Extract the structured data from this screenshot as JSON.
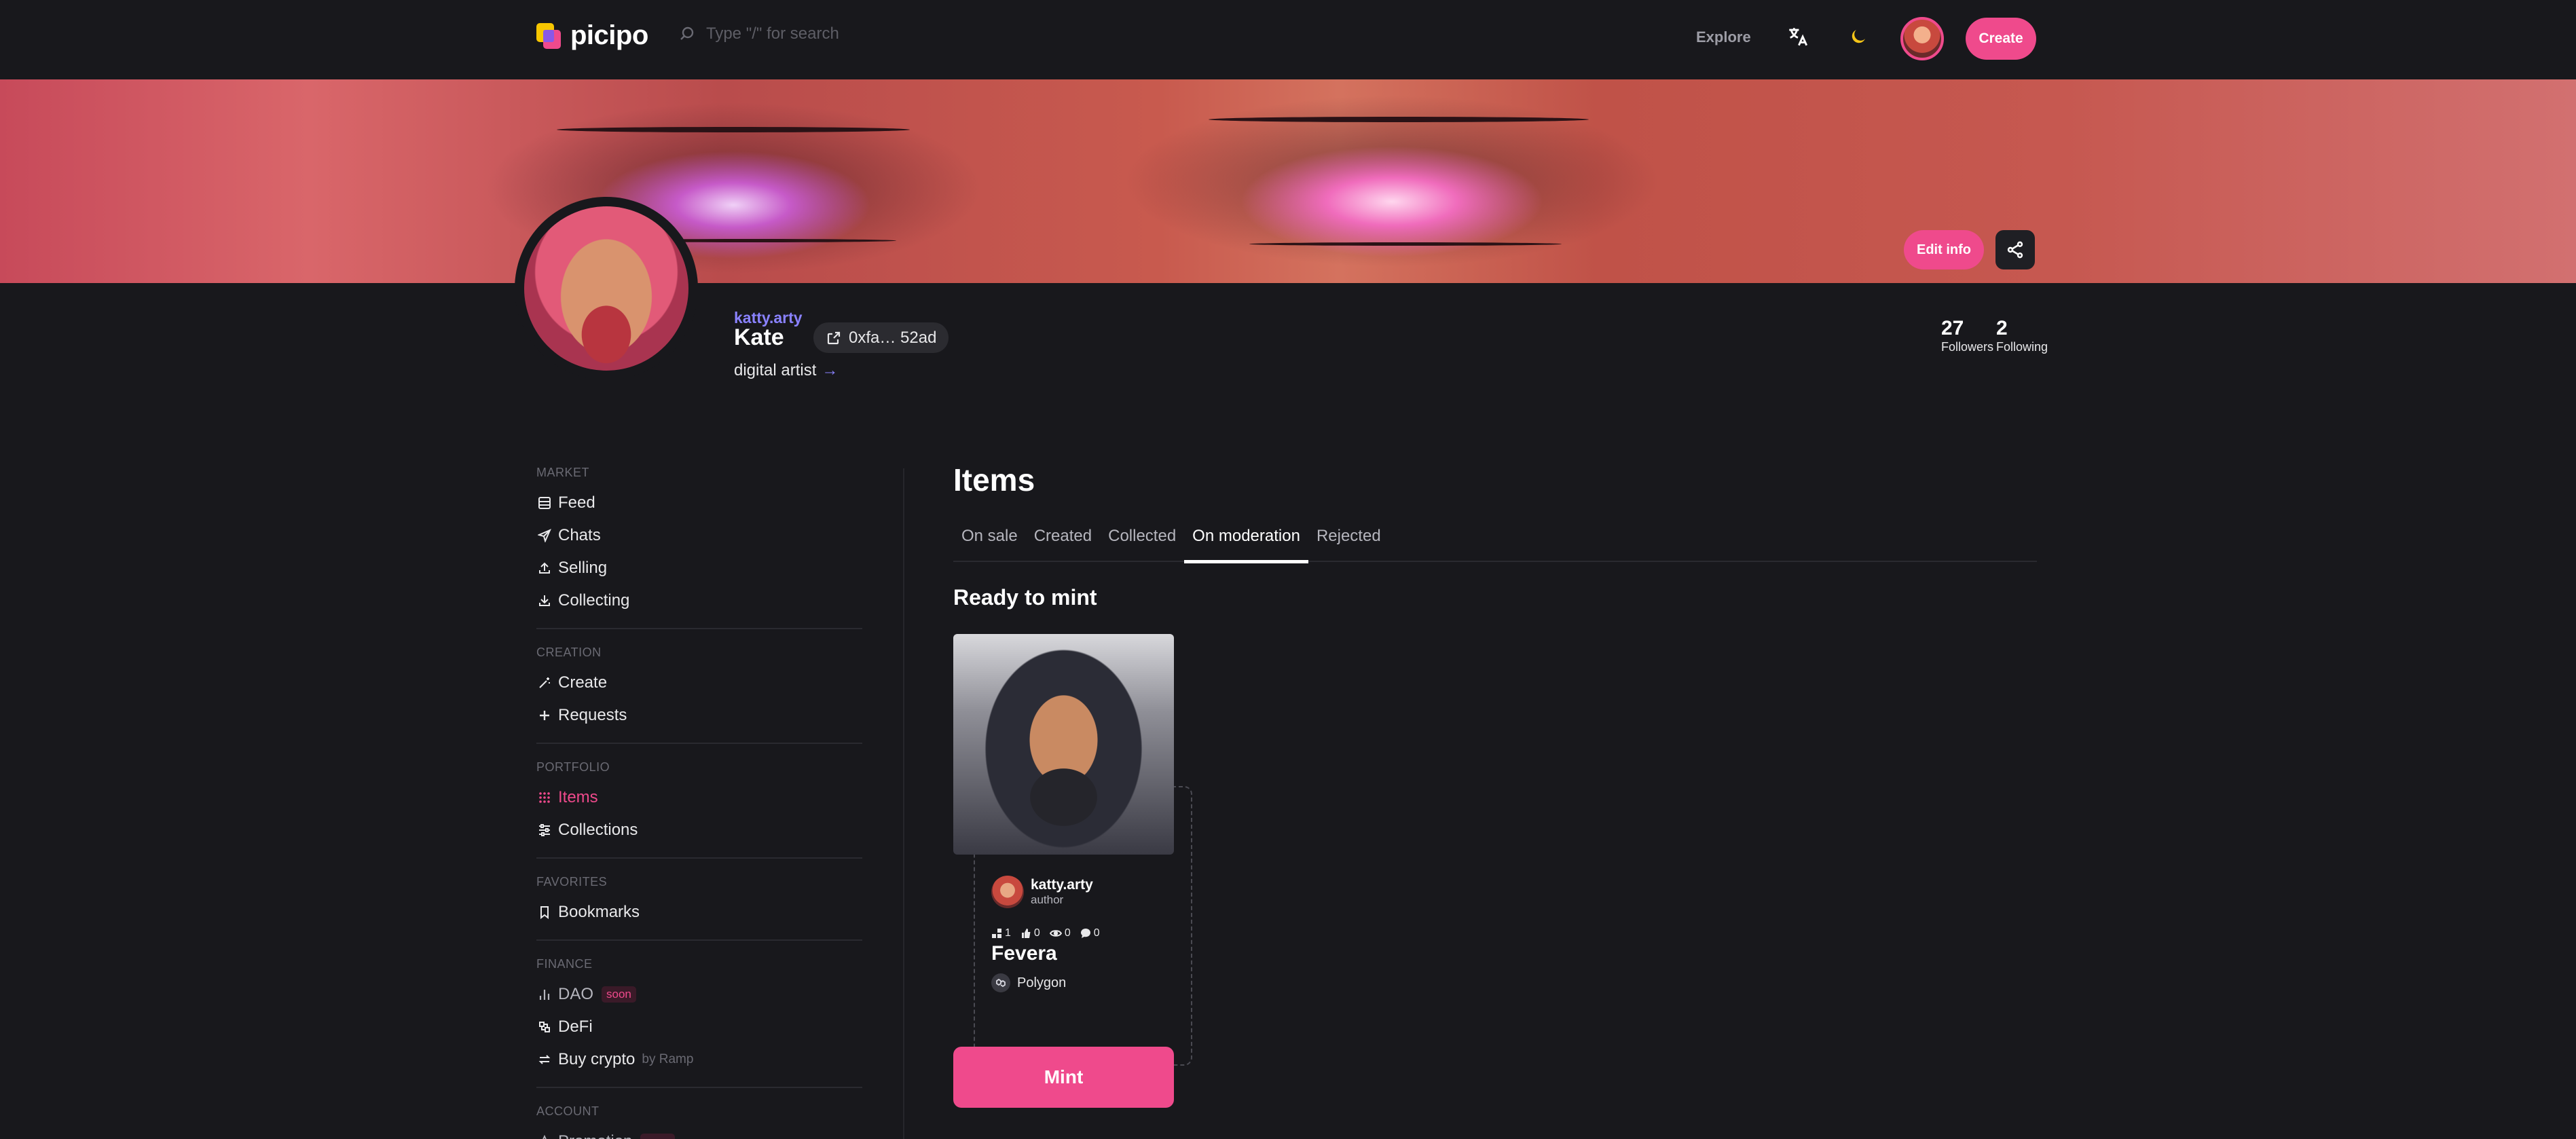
{
  "header": {
    "logo_text": "picipo",
    "search_placeholder": "Type \"/\" for search",
    "explore_label": "Explore",
    "create_label": "Create",
    "icons": [
      "search-icon",
      "translate-icon",
      "moon-icon"
    ]
  },
  "profile": {
    "username": "katty.arty",
    "name": "Kate",
    "address": "0xfa… 52ad",
    "bio": "digital artist",
    "edit_label": "Edit info",
    "followers_count": "27",
    "followers_label": "Followers",
    "following_count": "2",
    "following_label": "Following"
  },
  "sidebar": {
    "sections": [
      {
        "title": "MARKET",
        "items": [
          {
            "label": "Feed",
            "icon": "feed-icon"
          },
          {
            "label": "Chats",
            "icon": "send-icon"
          },
          {
            "label": "Selling",
            "icon": "upload-icon"
          },
          {
            "label": "Collecting",
            "icon": "download-icon"
          }
        ]
      },
      {
        "title": "CREATION",
        "items": [
          {
            "label": "Create",
            "icon": "magic-wand-icon"
          },
          {
            "label": "Requests",
            "icon": "plus-icon"
          }
        ]
      },
      {
        "title": "PORTFOLIO",
        "items": [
          {
            "label": "Items",
            "icon": "grid-icon",
            "active": true
          },
          {
            "label": "Collections",
            "icon": "sliders-icon"
          }
        ]
      },
      {
        "title": "FAVORITES",
        "items": [
          {
            "label": "Bookmarks",
            "icon": "bookmark-icon"
          }
        ]
      },
      {
        "title": "FINANCE",
        "items": [
          {
            "label": "DAO",
            "icon": "bar-chart-icon",
            "badge": "soon"
          },
          {
            "label": "DeFi",
            "icon": "defi-icon"
          },
          {
            "label": "Buy crypto",
            "icon": "exchange-icon",
            "suffix": "by Ramp"
          }
        ]
      },
      {
        "title": "ACCOUNT",
        "items": [
          {
            "label": "Promotion",
            "icon": "star-icon",
            "badge": "soon"
          }
        ]
      }
    ]
  },
  "main": {
    "title": "Items",
    "tabs": [
      "On sale",
      "Created",
      "Collected",
      "On moderation",
      "Rejected"
    ],
    "active_tab": "On moderation",
    "section_title": "Ready to mint",
    "card": {
      "author_name": "katty.arty",
      "author_role": "author",
      "metrics": [
        {
          "icon": "editions-icon",
          "value": "1"
        },
        {
          "icon": "like-icon",
          "value": "0"
        },
        {
          "icon": "eye-icon",
          "value": "0"
        },
        {
          "icon": "comment-icon",
          "value": "0"
        }
      ],
      "item_name": "Fevera",
      "chain": "Polygon",
      "mint_label": "Mint"
    }
  },
  "colors": {
    "accent": "#ef4a8c",
    "link": "#8a82ff",
    "background": "#18181c"
  }
}
